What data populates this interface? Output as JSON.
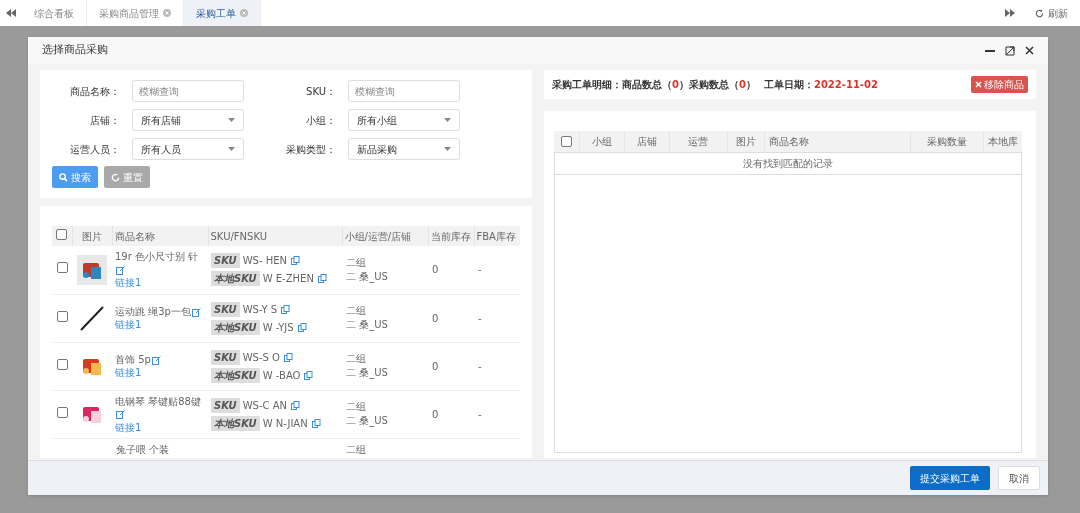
{
  "tabs": [
    {
      "label": "综合看板",
      "selected": false,
      "closable": false
    },
    {
      "label": "采购商品管理",
      "selected": false,
      "closable": true
    },
    {
      "label": "采购工单",
      "selected": true,
      "closable": true
    }
  ],
  "refresh": "刷新",
  "dialog": {
    "title": "选择商品采购",
    "filters": [
      {
        "label": "商品名称：",
        "kind": "input",
        "placeholder": "模糊查询"
      },
      {
        "label": "SKU：",
        "kind": "input",
        "placeholder": "模糊查询"
      },
      {
        "label": "店铺：",
        "kind": "select",
        "value": "所有店铺"
      },
      {
        "label": "小组：",
        "kind": "select",
        "value": "所有小组"
      },
      {
        "label": "运营人员：",
        "kind": "select",
        "value": "所有人员"
      },
      {
        "label": "采购类型：",
        "kind": "select",
        "value": "新品采购"
      }
    ],
    "search_button": "搜索",
    "reset_button": "重置",
    "left_table": {
      "all_checked": false,
      "columns": [
        "图片",
        "商品名称",
        "SKU/FNSKU",
        "小组/运营/店铺",
        "当前库存",
        "FBA库存"
      ],
      "rows": [
        {
          "checked": false,
          "name": "19r 色小尺寸别 针",
          "link": "链接1",
          "sku_tag": "SKU",
          "sku": "WS- HEN",
          "local_tag": "本地SKU",
          "local_sku": "W E-ZHEN",
          "group": "二组",
          "store": "二 桑_US",
          "stock": "0",
          "fba": "-"
        },
        {
          "checked": false,
          "name": "运动跳 绳3p一包",
          "link": "链接1",
          "sku_tag": "SKU",
          "sku": "WS-Y S",
          "local_tag": "本地SKU",
          "local_sku": "W -YJS",
          "group": "二组",
          "store": "二 桑_US",
          "stock": "0",
          "fba": "-"
        },
        {
          "checked": false,
          "name": "首饰 5p",
          "link": "链接1",
          "sku_tag": "SKU",
          "sku": "WS-S O",
          "local_tag": "本地SKU",
          "local_sku": "W -BAO",
          "group": "二组",
          "store": "二 桑_US",
          "stock": "0",
          "fba": "-"
        },
        {
          "checked": false,
          "name": "电钢琴 琴键贴88键",
          "link": "链接1",
          "sku_tag": "SKU",
          "sku": "WS-C AN",
          "local_tag": "本地SKU",
          "local_sku": "W N-JIAN",
          "group": "二组",
          "store": "二 桑_US",
          "stock": "0",
          "fba": "-"
        }
      ],
      "partial_row": {
        "name": "兔子喂 个装",
        "group": "二组"
      }
    },
    "summary": {
      "label": "采购工单明细：商品数总（",
      "count": "0",
      "mid": "）采购数总（",
      "qty": "0",
      "end": "）",
      "date_label": "工单日期：",
      "date": "2022-11-02"
    },
    "remove_button": "移除商品",
    "right_table": {
      "all_checked": false,
      "columns": [
        "小组",
        "店铺",
        "运营",
        "图片",
        "商品名称",
        "采购数量",
        "本地库"
      ],
      "empty": "没有找到匹配的记录"
    },
    "submit_button": "提交采购工单",
    "cancel_button": "取消"
  }
}
